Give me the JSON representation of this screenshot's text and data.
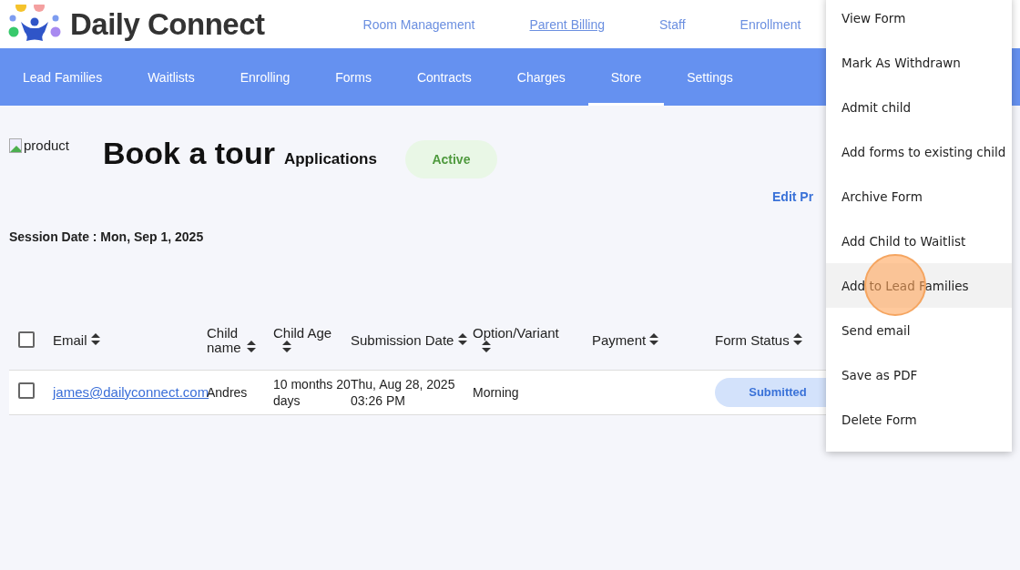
{
  "header": {
    "brand": "Daily Connect",
    "links": [
      {
        "label": "Room Management",
        "selected": false
      },
      {
        "label": "Parent Billing",
        "selected": true
      },
      {
        "label": "Staff",
        "selected": false
      },
      {
        "label": "Enrollment",
        "selected": false
      }
    ]
  },
  "tabs": [
    {
      "label": "Lead Families",
      "selected": false
    },
    {
      "label": "Waitlists",
      "selected": false
    },
    {
      "label": "Enrolling",
      "selected": false
    },
    {
      "label": "Forms",
      "selected": false
    },
    {
      "label": "Contracts",
      "selected": false
    },
    {
      "label": "Charges",
      "selected": false
    },
    {
      "label": "Store",
      "selected": true
    },
    {
      "label": "Settings",
      "selected": false
    }
  ],
  "product": {
    "image_alt": "product",
    "title": "Book a tour",
    "subtitle": "Applications",
    "status": "Active",
    "edit_link": "Edit Pr",
    "session_date": "Session Date : Mon, Sep 1, 2025"
  },
  "table": {
    "select_all_checked": false,
    "columns": [
      "Email",
      "Child name",
      "Child Age",
      "Submission Date",
      "Option/Variant",
      "Payment",
      "Form Status"
    ],
    "rows": [
      {
        "checked": false,
        "email": "james@dailyconnect.com",
        "child_name": "Andres",
        "child_age": "10 months 20 days",
        "submission_date": "Thu, Aug 28, 2025 03:26 PM",
        "option": "Morning",
        "form_status": "Submitted"
      }
    ]
  },
  "menu": {
    "items": [
      {
        "label": "View Form",
        "highlighted": false
      },
      {
        "label": "Mark As Withdrawn",
        "highlighted": false
      },
      {
        "label": "Admit child",
        "highlighted": false
      },
      {
        "label": "Add forms to existing child",
        "highlighted": false
      },
      {
        "label": "Archive Form",
        "highlighted": false
      },
      {
        "label": "Add Child to Waitlist",
        "highlighted": false
      },
      {
        "label": "Add to Lead Families",
        "highlighted": true
      },
      {
        "label": "Send email",
        "highlighted": false
      },
      {
        "label": "Save as PDF",
        "highlighted": false
      },
      {
        "label": "Delete Form",
        "highlighted": false
      }
    ]
  }
}
